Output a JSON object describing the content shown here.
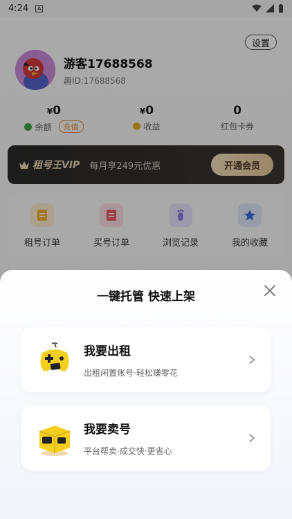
{
  "status": {
    "time": "4:24",
    "notif_glyph": "A"
  },
  "profile": {
    "settings_label": "设置",
    "username": "游客17688568",
    "user_id": "趣ID:17688568"
  },
  "stats": [
    {
      "currency": "¥",
      "value": "0",
      "label": "余额",
      "action": "充值",
      "dot_color": "#3aa34a"
    },
    {
      "currency": "¥",
      "value": "0",
      "label": "收益",
      "dot_color": "#e0b020"
    },
    {
      "value": "0",
      "label": "红包卡券"
    }
  ],
  "vip": {
    "brand": "租号王VIP",
    "promo": "每月享249元优惠",
    "button": "开通会员"
  },
  "shortcuts": [
    {
      "label": "租号订单",
      "icon": "rent-order-icon",
      "color": "#f0b030"
    },
    {
      "label": "买号订单",
      "icon": "buy-order-icon",
      "color": "#e85a6a"
    },
    {
      "label": "浏览记录",
      "icon": "footprint-icon",
      "color": "#8a7ae0"
    },
    {
      "label": "我的收藏",
      "icon": "star-icon",
      "color": "#3a6ad8"
    }
  ],
  "sheet": {
    "title": "一键托管 快速上架",
    "options": [
      {
        "title": "我要出租",
        "subtitle": "出租闲置账号·轻松赚零花",
        "icon": "gamepad-icon"
      },
      {
        "title": "我要卖号",
        "subtitle": "平台帮卖·成交快·更省心",
        "icon": "box-icon"
      }
    ]
  }
}
